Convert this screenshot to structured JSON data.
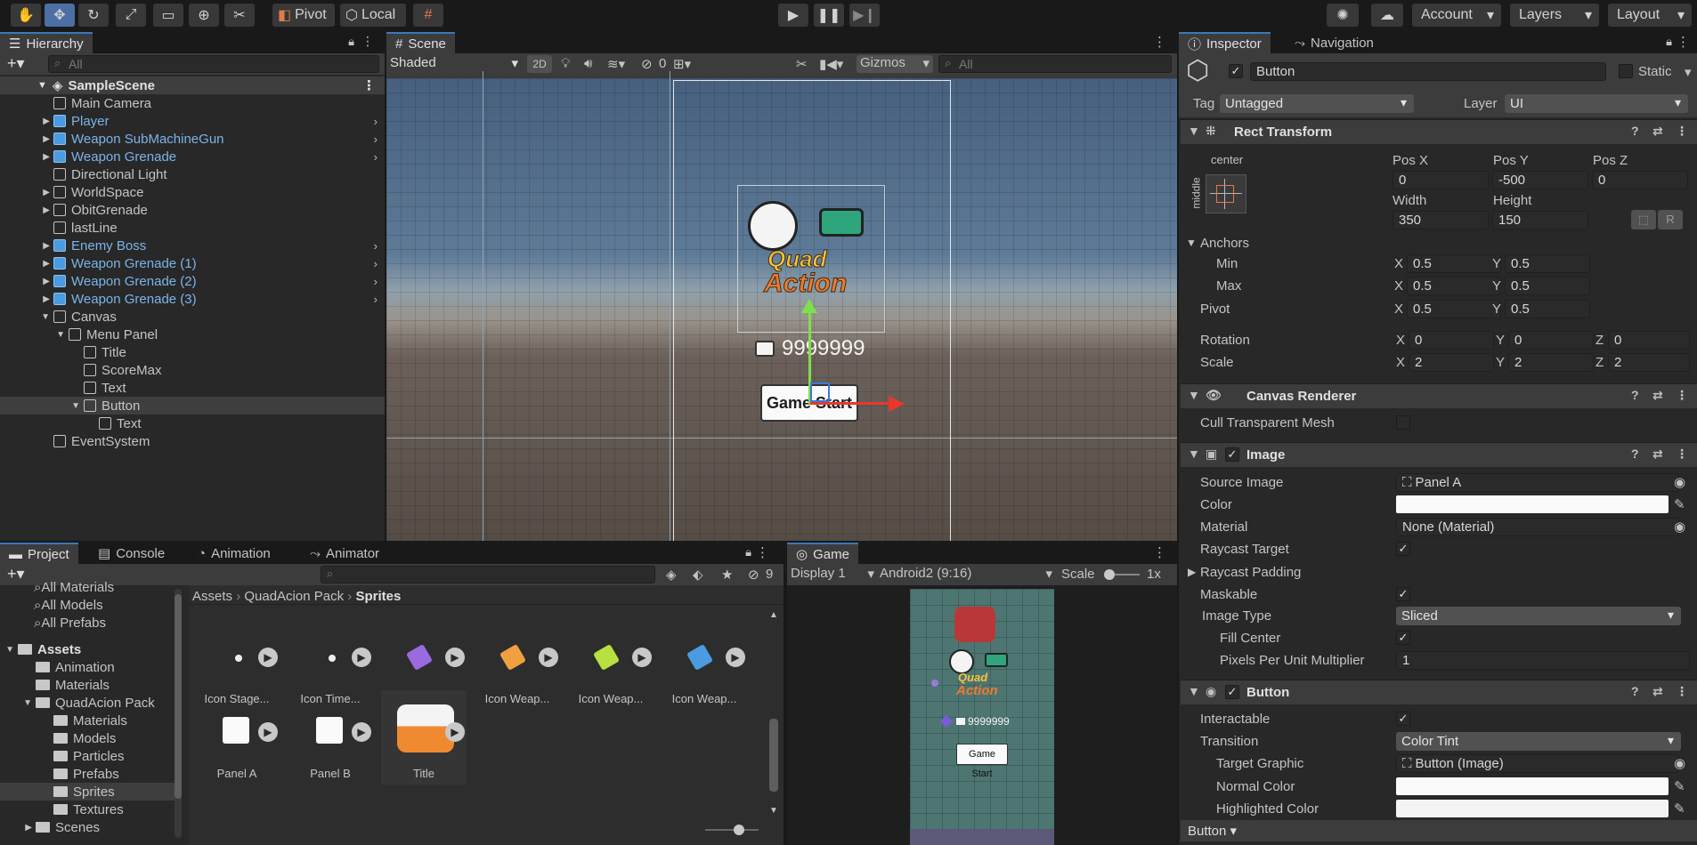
{
  "toolbar": {
    "pivot": "Pivot",
    "local": "Local",
    "account": "Account",
    "layers": "Layers",
    "layout": "Layout"
  },
  "hierarchy": {
    "tab": "Hierarchy",
    "search_placeholder": "All",
    "scene": "SampleScene",
    "items": [
      {
        "label": "Main Camera",
        "prefab": false
      },
      {
        "label": "Player",
        "prefab": true
      },
      {
        "label": "Weapon SubMachineGun",
        "prefab": true
      },
      {
        "label": "Weapon Grenade",
        "prefab": true
      },
      {
        "label": "Directional Light",
        "prefab": false
      },
      {
        "label": "WorldSpace",
        "prefab": false
      },
      {
        "label": "ObitGrenade",
        "prefab": false
      },
      {
        "label": "lastLine",
        "prefab": false
      },
      {
        "label": "Enemy Boss",
        "prefab": true
      },
      {
        "label": "Weapon Grenade (1)",
        "prefab": true
      },
      {
        "label": "Weapon Grenade (2)",
        "prefab": true
      },
      {
        "label": "Weapon Grenade (3)",
        "prefab": true
      },
      {
        "label": "Canvas",
        "prefab": false
      },
      {
        "label": "Menu Panel",
        "prefab": false
      },
      {
        "label": "Title",
        "prefab": false
      },
      {
        "label": "ScoreMax",
        "prefab": false
      },
      {
        "label": "Text",
        "prefab": false
      },
      {
        "label": "Button",
        "prefab": false
      },
      {
        "label": "Text",
        "prefab": false
      },
      {
        "label": "EventSystem",
        "prefab": false
      }
    ]
  },
  "scene": {
    "tab": "Scene",
    "shading": "Shaded",
    "mode2d": "2D",
    "hidden_count": "0",
    "gizmos": "Gizmos",
    "search_placeholder": "All",
    "score": "9999999",
    "button_label": "Game Start",
    "logo_line1": "Quad",
    "logo_line2": "Action"
  },
  "project": {
    "tabs": [
      "Project",
      "Console",
      "Animation",
      "Animator"
    ],
    "hidden_count": "9",
    "favorites": [
      "All Materials",
      "All Models",
      "All Prefabs"
    ],
    "tree": [
      {
        "label": "Assets",
        "depth": 0,
        "bold": true
      },
      {
        "label": "Animation",
        "depth": 1
      },
      {
        "label": "Materials",
        "depth": 1
      },
      {
        "label": "QuadAcion Pack",
        "depth": 1
      },
      {
        "label": "Materials",
        "depth": 2
      },
      {
        "label": "Models",
        "depth": 2
      },
      {
        "label": "Particles",
        "depth": 2
      },
      {
        "label": "Prefabs",
        "depth": 2
      },
      {
        "label": "Sprites",
        "depth": 2
      },
      {
        "label": "Textures",
        "depth": 2
      },
      {
        "label": "Scenes",
        "depth": 1
      }
    ],
    "breadcrumb": [
      "Assets",
      "QuadAcion Pack",
      "Sprites"
    ],
    "assets": [
      "Icon Stage...",
      "Icon Time...",
      "Icon Weap...",
      "Icon Weap...",
      "Icon Weap...",
      "Icon Weap...",
      "Panel A",
      "Panel B",
      "Title"
    ]
  },
  "game": {
    "tab": "Game",
    "display": "Display 1",
    "aspect": "Android2 (9:16)",
    "scale_label": "Scale",
    "scale_value": "1x",
    "score": "9999999",
    "button_label": "Game Start"
  },
  "inspector": {
    "tabs": [
      "Inspector",
      "Navigation"
    ],
    "name": "Button",
    "static": "Static",
    "tag_label": "Tag",
    "tag": "Untagged",
    "layer_label": "Layer",
    "layer": "UI",
    "rect": {
      "title": "Rect Transform",
      "anchor_h": "center",
      "anchor_v": "middle",
      "pos_x_label": "Pos X",
      "pos_y_label": "Pos Y",
      "pos_z_label": "Pos Z",
      "pos_x": "0",
      "pos_y": "-500",
      "pos_z": "0",
      "width_label": "Width",
      "height_label": "Height",
      "width": "350",
      "height": "150",
      "anchors": "Anchors",
      "min": "Min",
      "max": "Max",
      "min_x": "0.5",
      "min_y": "0.5",
      "max_x": "0.5",
      "max_y": "0.5",
      "pivot": "Pivot",
      "pivot_x": "0.5",
      "pivot_y": "0.5",
      "rotation": "Rotation",
      "rot_x": "0",
      "rot_y": "0",
      "rot_z": "0",
      "scale": "Scale",
      "scale_x": "2",
      "scale_y": "2",
      "scale_z": "2",
      "x": "X",
      "y": "Y",
      "z": "Z",
      "r": "R"
    },
    "canvas_renderer": {
      "title": "Canvas Renderer",
      "cull": "Cull Transparent Mesh"
    },
    "image": {
      "title": "Image",
      "source_label": "Source Image",
      "source": "Panel A",
      "color_label": "Color",
      "material_label": "Material",
      "material": "None (Material)",
      "raycast_target": "Raycast Target",
      "raycast_padding": "Raycast Padding",
      "maskable": "Maskable",
      "image_type_label": "Image Type",
      "image_type": "Sliced",
      "fill_center": "Fill Center",
      "ppu_label": "Pixels Per Unit Multiplier",
      "ppu": "1"
    },
    "button": {
      "title": "Button",
      "interactable": "Interactable",
      "transition_label": "Transition",
      "transition": "Color Tint",
      "target_label": "Target Graphic",
      "target": "Button (Image)",
      "normal": "Normal Color",
      "highlighted": "Highlighted Color"
    },
    "footer": "Button"
  },
  "colors": {
    "accent": "#3a79bb",
    "prefab_blue": "#7cb3ea",
    "arrow_red": "#e8382c",
    "arrow_green": "#7ee04a"
  }
}
